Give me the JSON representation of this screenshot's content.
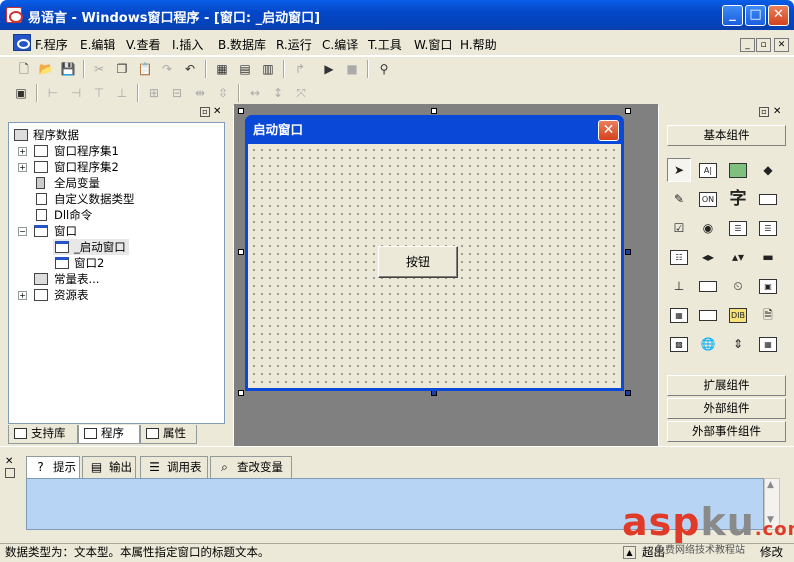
{
  "window": {
    "title": "易语言 - Windows窗口程序 - [窗口: _启动窗口]",
    "min": "_",
    "max": "□",
    "close": "✕"
  },
  "menu": [
    {
      "key": "F.",
      "label": "程序"
    },
    {
      "key": "E.",
      "label": "编辑"
    },
    {
      "key": "V.",
      "label": "查看"
    },
    {
      "key": "I.",
      "label": "插入"
    },
    {
      "key": "B.",
      "label": "数据库"
    },
    {
      "key": "R.",
      "label": "运行"
    },
    {
      "key": "C.",
      "label": "编译"
    },
    {
      "key": "T.",
      "label": "工具"
    },
    {
      "key": "W.",
      "label": "窗口"
    },
    {
      "key": "H.",
      "label": "帮助"
    }
  ],
  "tree": {
    "root": "程序数据",
    "nodes": [
      "窗口程序集1",
      "窗口程序集2",
      "全局变量",
      "自定义数据类型",
      "Dll命令",
      "窗口",
      "_启动窗口",
      "窗口2",
      "常量表...",
      "资源表"
    ]
  },
  "left_tabs": [
    "支持库",
    "程序",
    "属性"
  ],
  "design": {
    "form_title": "启动窗口",
    "button_label": "按钮",
    "close": "✕"
  },
  "components": {
    "basic": "基本组件",
    "extended": "扩展组件",
    "external": "外部组件",
    "external_events": "外部事件组件",
    "char_icon": "字",
    "button_icon_label": "ON"
  },
  "bottom_tabs": [
    "提示",
    "输出",
    "调用表",
    "查改变量"
  ],
  "status": {
    "text": "数据类型为：文本型。本属性指定窗口的标题文本。",
    "right": "超出",
    "right2": "修改"
  },
  "watermark": {
    "brand_a": "asp",
    "brand_b": "ku",
    "brand_c": ".com",
    "sub": "免费网络技术教程站"
  },
  "colors": {
    "titlebar": "#0447c9",
    "output_bg": "#b8d4f5",
    "form_bg": "#ece9d8"
  }
}
